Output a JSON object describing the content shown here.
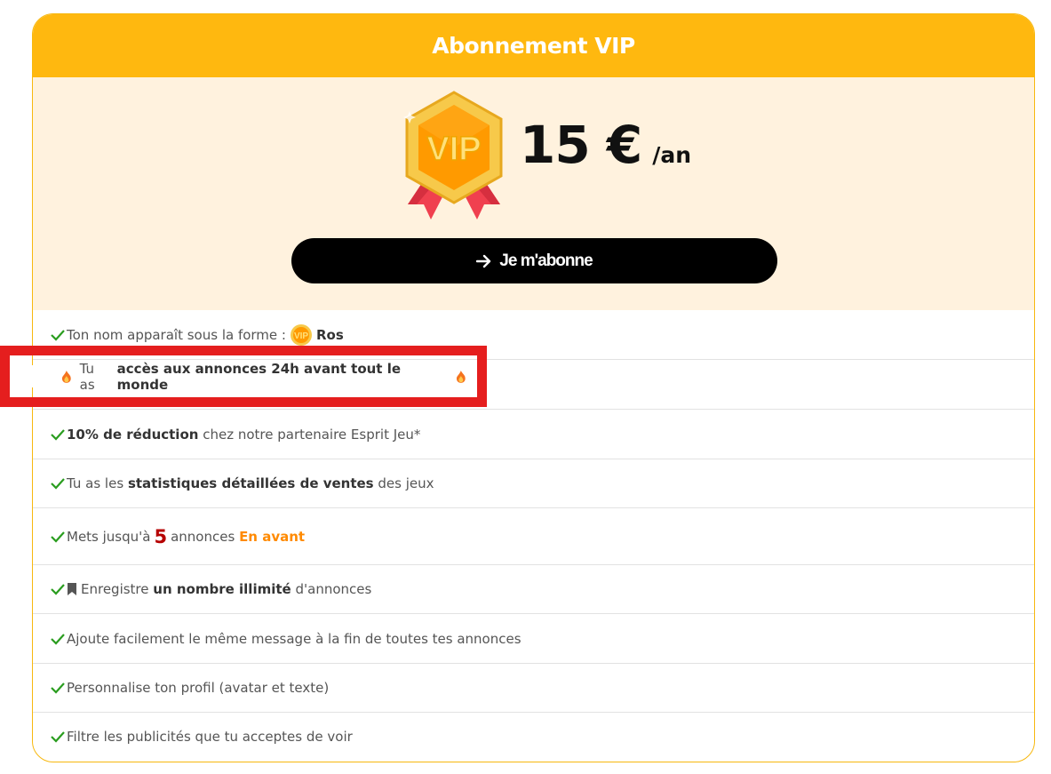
{
  "card": {
    "title": "Abonnement VIP",
    "badge_text": "VIP",
    "price_amount": "15 €",
    "price_period": "/an",
    "subscribe_label": "Je m'abonne"
  },
  "features": [
    {
      "pre": "Ton nom apparaît sous la forme :",
      "bold": "Ros",
      "vip_badge": "VIP"
    },
    {
      "pre": "Tu as",
      "bold": "accès aux annonces 24h avant tout le monde"
    },
    {
      "bold": "10% de réduction",
      "post": "chez notre partenaire Esprit Jeu*"
    },
    {
      "pre": "Tu as les",
      "bold": "statistiques détaillées de ventes",
      "post": "des jeux"
    },
    {
      "pre": "Mets jusqu'à",
      "count": "5",
      "mid": "annonces",
      "accent": "En avant"
    },
    {
      "pre": "Enregistre",
      "bold": "un nombre illimité",
      "post": "d'annonces"
    },
    {
      "pre": "Ajoute facilement le même message à la fin de toutes tes annonces"
    },
    {
      "pre": "Personnalise ton profil (avatar et texte)"
    },
    {
      "pre": "Filtre les publicités que tu acceptes de voir"
    }
  ],
  "colors": {
    "header": "#ffb80f",
    "price_bg": "#fff2de",
    "check": "#2a9d1f",
    "highlight": "#e51e1e",
    "accent": "#ff8a00",
    "count": "#b60000"
  },
  "icons": [
    "check-icon",
    "vip-badge-icon",
    "flame-icon",
    "bookmark-icon",
    "arrow-right-icon"
  ]
}
